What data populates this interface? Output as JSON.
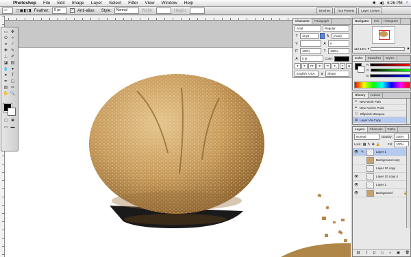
{
  "menubar": {
    "app": "Photoshop",
    "menus": [
      "File",
      "Edit",
      "Image",
      "Layer",
      "Select",
      "Filter",
      "View",
      "Window",
      "Help"
    ],
    "clock": "6:26 PM"
  },
  "options": {
    "feather_label": "Feather:",
    "feather_value": "0 px",
    "antialias_label": "Anti-alias",
    "style_label": "Style:",
    "style_value": "Normal",
    "width_label": "Width:",
    "height_label": "Height:",
    "wells": [
      "Brushes",
      "Tool Presets",
      "Layer Comps"
    ]
  },
  "character": {
    "tabs": [
      "Character",
      "Paragraph"
    ],
    "font": "Arial",
    "font_style": "Regular",
    "size": "10 pt",
    "leading": "(Auto)",
    "tracking": "0",
    "vscale": "100%",
    "hscale": "100%",
    "baseline": "0 pt",
    "color_label": "Color:",
    "language": "English: USA",
    "aa": "Sharp",
    "style_buttons": [
      "T",
      "T",
      "TT",
      "Tr",
      "T¹",
      "T₁",
      "T",
      "T"
    ]
  },
  "navigator": {
    "tabs": [
      "Navigator",
      "Info",
      "Histogram"
    ],
    "zoom": "112.13%"
  },
  "color": {
    "tabs": [
      "Color",
      "Swatches",
      "Styles"
    ],
    "channels": [
      "R",
      "G",
      "B"
    ]
  },
  "history": {
    "tabs": [
      "History",
      "Actions"
    ],
    "items": [
      "New Work Path",
      "New Anchor Point",
      "Elliptical Marquee",
      "Layer Via Copy"
    ]
  },
  "layers": {
    "tabs": [
      "Layers",
      "Channels",
      "Paths"
    ],
    "blend_mode": "Normal",
    "opacity_label": "Opacity:",
    "opacity": "100%",
    "lock_label": "Lock:",
    "fill_label": "Fill:",
    "fill": "100%",
    "items": [
      "Layer 1",
      "Background copy",
      "Layer 10 copy",
      "Layer 10 copy 4",
      "Layer 2",
      "Background"
    ]
  },
  "colors": {
    "accent": "#5a88d8",
    "selection": "#b6c9ee"
  }
}
